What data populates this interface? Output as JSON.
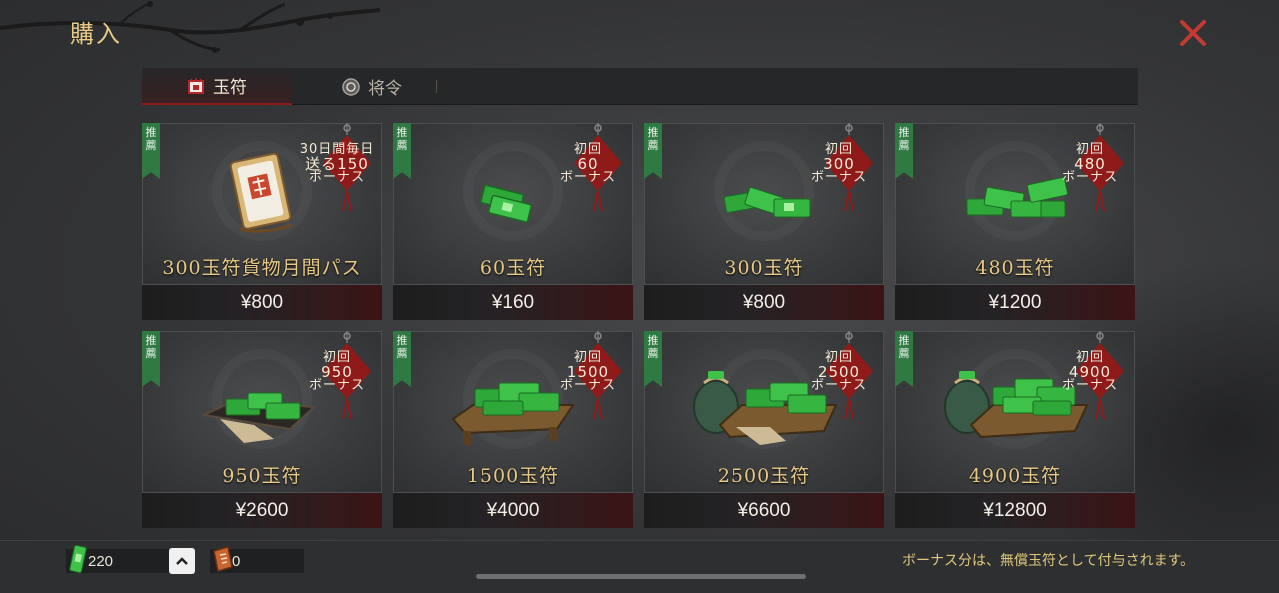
{
  "window": {
    "title": "購入"
  },
  "tabs": [
    {
      "label": "玉符",
      "icon": "jade-seal-icon",
      "active": true
    },
    {
      "label": "将令",
      "icon": "command-token-icon",
      "active": false
    }
  ],
  "products": [
    {
      "badge": "推薦",
      "bonus_lines": [
        "30日間毎日",
        "送る150",
        "ボーナス"
      ],
      "name": "300玉符貨物月間パス",
      "price": "¥800",
      "art": "monthly-pass-icon"
    },
    {
      "badge": "推薦",
      "bonus_lines": [
        "初回",
        "60",
        "ボーナス"
      ],
      "name": "60玉符",
      "price": "¥160",
      "art": "jade-small-icon"
    },
    {
      "badge": "推薦",
      "bonus_lines": [
        "初回",
        "300",
        "ボーナス"
      ],
      "name": "300玉符",
      "price": "¥800",
      "art": "jade-pile-icon"
    },
    {
      "badge": "推薦",
      "bonus_lines": [
        "初回",
        "480",
        "ボーナス"
      ],
      "name": "480玉符",
      "price": "¥1200",
      "art": "jade-pile-large-icon"
    },
    {
      "badge": "推薦",
      "bonus_lines": [
        "初回",
        "950",
        "ボーナス"
      ],
      "name": "950玉符",
      "price": "¥2600",
      "art": "jade-tray-icon"
    },
    {
      "badge": "推薦",
      "bonus_lines": [
        "初回",
        "1500",
        "ボーナス"
      ],
      "name": "1500玉符",
      "price": "¥4000",
      "art": "jade-box-icon"
    },
    {
      "badge": "推薦",
      "bonus_lines": [
        "初回",
        "2500",
        "ボーナス"
      ],
      "name": "2500玉符",
      "price": "¥6600",
      "art": "jade-sack-box-icon"
    },
    {
      "badge": "推薦",
      "bonus_lines": [
        "初回",
        "4900",
        "ボーナス"
      ],
      "name": "4900玉符",
      "price": "¥12800",
      "art": "jade-sack-box-large-icon"
    }
  ],
  "footer": {
    "jade_amount": "220",
    "token_amount": "0",
    "note": "ボーナス分は、無償玉符として付与されます。"
  },
  "colors": {
    "gold": "#e7c985",
    "jade": "#3fbf3a",
    "ribbon": "#2f7a43",
    "knot": "#8f1a1a",
    "close": "#c0392b"
  }
}
